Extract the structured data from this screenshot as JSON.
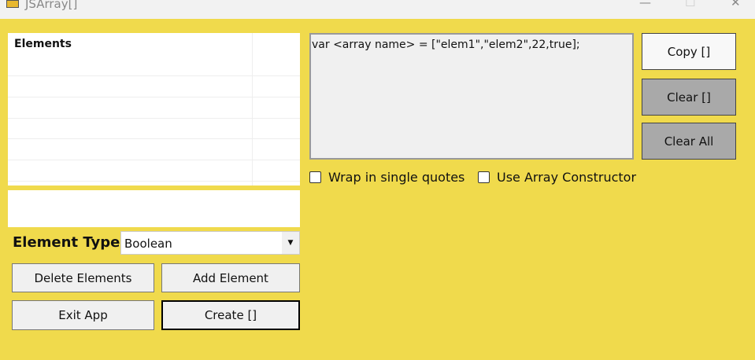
{
  "window": {
    "title": "JSArray[]",
    "minimize": "—",
    "maximize": "☐",
    "close": "✕"
  },
  "grid": {
    "header": "Elements"
  },
  "element_type": {
    "label": "Element Type",
    "value": "Boolean"
  },
  "buttons": {
    "delete": "Delete Elements",
    "add": "Add Element",
    "exit": "Exit App",
    "create": "Create []",
    "copy": "Copy []",
    "clear": "Clear []",
    "clear_all": "Clear All"
  },
  "output": {
    "text": "var <array name> = [\"elem1\",\"elem2\",22,true];"
  },
  "options": {
    "wrap_single_quotes": "Wrap in single quotes",
    "use_array_constructor": "Use Array Constructor"
  }
}
